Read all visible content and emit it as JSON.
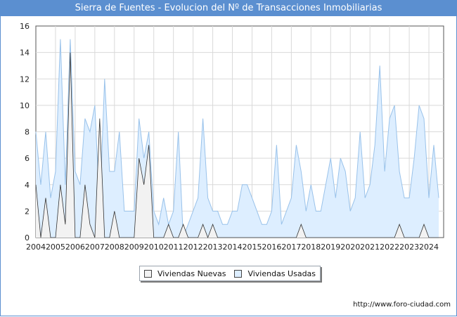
{
  "title": "Sierra de Fuentes - Evolucion del Nº de Transacciones Inmobiliarias",
  "footer_url": "http://www.foro-ciudad.com",
  "colors": {
    "title_bg": "#5b8fd0",
    "nuevas_fill": "#f2f2f2",
    "usadas_fill": "#ddeeff",
    "usadas_line": "#99c2ea",
    "nuevas_line": "#333333",
    "grid": "#d9d9d9"
  },
  "chart_data": {
    "type": "area",
    "title": "Sierra de Fuentes - Evolucion del Nº de Transacciones Inmobiliarias",
    "xlabel": "",
    "ylabel": "",
    "ylim": [
      0,
      16
    ],
    "yticks": [
      "0",
      "2",
      "4",
      "6",
      "8",
      "10",
      "12",
      "14",
      "16"
    ],
    "xlim": [
      2004,
      2024.75
    ],
    "xticks": [
      "2004",
      "2005",
      "2006",
      "2007",
      "2008",
      "2009",
      "2010",
      "2011",
      "2012",
      "2013",
      "2014",
      "2015",
      "2016",
      "2017",
      "2018",
      "2019",
      "2020",
      "2021",
      "2022",
      "2023",
      "2024"
    ],
    "grid": true,
    "legend_position": "bottom-center",
    "x_step_months": 3,
    "series": [
      {
        "name": "Viviendas Usadas",
        "values": [
          8,
          4,
          8,
          3,
          5,
          15,
          4,
          15,
          5,
          4,
          9,
          8,
          10,
          2,
          12,
          5,
          5,
          8,
          2,
          2,
          2,
          9,
          6,
          8,
          2,
          1,
          3,
          1,
          2,
          8,
          0,
          1,
          2,
          3,
          9,
          3,
          2,
          2,
          1,
          1,
          2,
          2,
          4,
          4,
          3,
          2,
          1,
          1,
          2,
          7,
          1,
          2,
          3,
          7,
          5,
          2,
          4,
          2,
          2,
          4,
          6,
          3,
          6,
          5,
          2,
          3,
          8,
          3,
          4,
          7,
          13,
          5,
          9,
          10,
          5,
          3,
          3,
          6,
          10,
          9,
          3,
          7,
          3
        ]
      },
      {
        "name": "Viviendas Nuevas",
        "values": [
          4,
          0,
          3,
          0,
          0,
          4,
          1,
          14,
          0,
          0,
          4,
          1,
          0,
          9,
          0,
          0,
          2,
          0,
          0,
          0,
          0,
          6,
          4,
          7,
          0,
          0,
          0,
          1,
          0,
          0,
          1,
          0,
          0,
          0,
          1,
          0,
          1,
          0,
          0,
          0,
          0,
          0,
          0,
          0,
          0,
          0,
          0,
          0,
          0,
          0,
          0,
          0,
          0,
          0,
          1,
          0,
          0,
          0,
          0,
          0,
          0,
          0,
          0,
          0,
          0,
          0,
          0,
          0,
          0,
          0,
          0,
          0,
          0,
          0,
          1,
          0,
          0,
          0,
          0,
          1,
          0,
          0,
          0
        ]
      }
    ]
  }
}
